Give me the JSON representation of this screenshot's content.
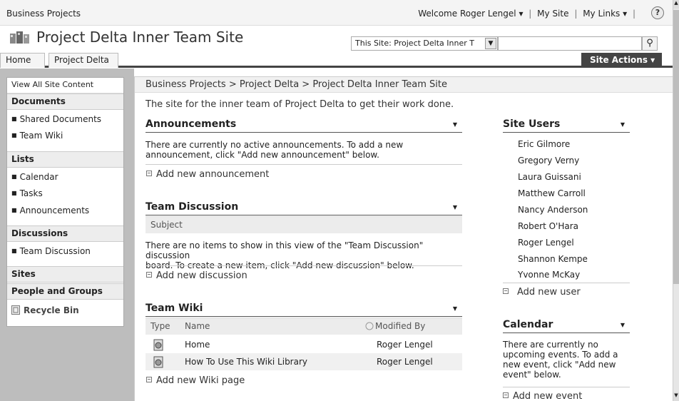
{
  "topbar": {
    "site_collection": "Business Projects",
    "welcome": "Welcome Roger Lengel ▾",
    "my_site": "My Site",
    "my_links": "My Links ▾",
    "separator": "|",
    "help_icon": "?"
  },
  "header": {
    "site_title": "Project Delta Inner Team Site",
    "search_scope": "This Site: Project Delta Inner T",
    "search_value": "",
    "search_button_glyph": "⚲"
  },
  "nav": {
    "tabs": [
      "Home",
      "Project Delta"
    ],
    "site_actions": "Site Actions ▾"
  },
  "quicklaunch": {
    "view_all": "View All Site Content",
    "documents": {
      "heading": "Documents",
      "items": [
        "Shared Documents",
        "Team Wiki"
      ]
    },
    "lists": {
      "heading": "Lists",
      "items": [
        "Calendar",
        "Tasks",
        "Announcements"
      ]
    },
    "discussions": {
      "heading": "Discussions",
      "items": [
        "Team Discussion"
      ]
    },
    "sites": "Sites",
    "people": "People and Groups",
    "recycle_bin": "Recycle Bin",
    "bullet": "■"
  },
  "main": {
    "breadcrumb": "Business Projects > Project Delta > Project Delta Inner Team Site",
    "description": "The site for the inner team of Project Delta to get their work done.",
    "announcements": {
      "title": "Announcements",
      "empty_line1": "There are currently no active announcements. To add a new",
      "empty_line2": "announcement, click \"Add new announcement\" below.",
      "add": "Add new announcement"
    },
    "discussion": {
      "title": "Team Discussion",
      "col_subject": "Subject",
      "empty_line1": "There are no items to show in this view of the \"Team Discussion\" discussion",
      "empty_line2": "board. To create a new item, click \"Add new discussion\" below.",
      "add": "Add new discussion"
    },
    "wiki": {
      "title": "Team Wiki",
      "col_type": "Type",
      "col_name": "Name",
      "col_modified": "Modified By",
      "rows": [
        {
          "name": "Home",
          "modified_by": "Roger Lengel"
        },
        {
          "name": "How To Use This Wiki Library",
          "modified_by": "Roger Lengel"
        }
      ],
      "add": "Add new Wiki page"
    },
    "site_users": {
      "title": "Site Users",
      "users": [
        "Eric Gilmore",
        "Gregory Verny",
        "Laura Guissani",
        "Matthew Carroll",
        "Nancy Anderson",
        "Robert O'Hara",
        "Roger Lengel",
        "Shannon Kempe",
        "Yvonne McKay"
      ],
      "add": "Add new user"
    },
    "calendar": {
      "title": "Calendar",
      "empty_lines": [
        "There are currently no",
        "upcoming events. To add a",
        "new event, click \"Add new",
        "event\" below."
      ],
      "add": "Add new event"
    },
    "menu_arrow": "▼"
  }
}
